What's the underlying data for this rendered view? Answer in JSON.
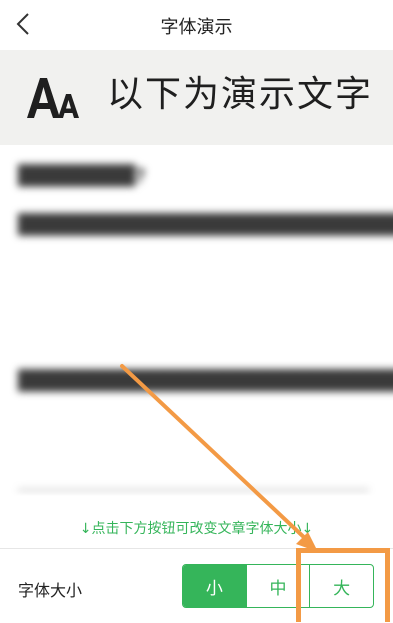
{
  "header": {
    "title": "字体演示"
  },
  "demo": {
    "text": "以下为演示文字"
  },
  "article": {
    "title": "████████?",
    "para1": "██████████████████████████████████████████████████████████████████████████████",
    "para2": "████████████████████████████████████████████████",
    "para3": "████████████████████████"
  },
  "hint": "↓点击下方按钮可改变文章字体大小↓",
  "font_size": {
    "label": "字体大小",
    "options": [
      "小",
      "中",
      "大"
    ],
    "selected": "小"
  },
  "colors": {
    "accent": "#35b55a",
    "annotation": "#f39a45"
  }
}
